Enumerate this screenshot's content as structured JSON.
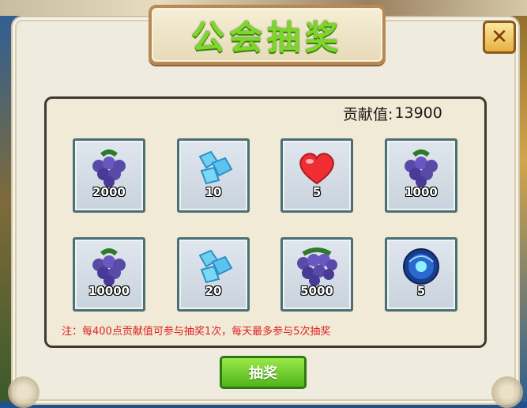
{
  "title": "公会抽奖",
  "close_glyph": "✕",
  "contribution": {
    "label": "贡献值:",
    "value": "13900"
  },
  "rewards": [
    {
      "icon": "grape-icon",
      "count": "2000"
    },
    {
      "icon": "diamond-icon",
      "count": "10"
    },
    {
      "icon": "heart-icon",
      "count": "5"
    },
    {
      "icon": "grape-icon",
      "count": "1000"
    },
    {
      "icon": "grape-icon",
      "count": "10000"
    },
    {
      "icon": "diamond-icon",
      "count": "20"
    },
    {
      "icon": "grape-icon",
      "count": "5000"
    },
    {
      "icon": "orb-icon",
      "count": "5"
    }
  ],
  "note": "注：每400点贡献值可参与抽奖1次，每天最多参与5次抽奖",
  "draw_button_label": "抽奖",
  "colors": {
    "title_green": "#7fd62a",
    "note_red": "#e02020",
    "button_green": "#4fb51a",
    "slot_border": "#4a6f74"
  }
}
